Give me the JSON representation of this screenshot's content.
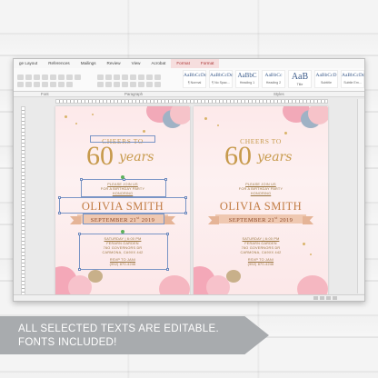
{
  "ribbon": {
    "tabs": [
      "ge Layout",
      "References",
      "Mailings",
      "Review",
      "View",
      "Acrobat",
      "Format",
      "Format"
    ],
    "group_labels": [
      "Font",
      "Paragraph",
      "Styles"
    ],
    "styles": [
      {
        "sample": "AaBbCcDc",
        "name": "¶ Normal"
      },
      {
        "sample": "AaBbCcDc",
        "name": "¶ No Spac..."
      },
      {
        "sample": "AaBbC",
        "name": "Heading 1"
      },
      {
        "sample": "AaBbCc",
        "name": "Heading 2"
      },
      {
        "sample": "AaB",
        "name": "Title"
      },
      {
        "sample": "AaBbCcD",
        "name": "Subtitle"
      },
      {
        "sample": "AaBbCcDc",
        "name": "Subtle Em..."
      }
    ]
  },
  "invitation": {
    "cheers": "CHEERS TO",
    "number": "60",
    "years": "years",
    "please": "PLEASE JOIN US",
    "for": "FOR A BIRTHDAY PARTY",
    "honoring": "HONORING",
    "name": "OLIVIA SMITH",
    "date_main": "SEPTEMBER 21",
    "date_sup": "st",
    "date_year": " 2019",
    "time": "SATURDAY | 6:00 PM",
    "venue": "FERARN GARDEN",
    "street": "76O GOVERNORS DR",
    "city": "CARMONA, CA9XX 442",
    "rsvp": "RSVP TO JANI",
    "phone": "(952) 870-4246"
  },
  "colors": {
    "gold": "#c79a4c",
    "name": "#c27c44",
    "ribbon": "#efc8b1",
    "page_bg": "#fde9ea",
    "selection": "#7a95c6",
    "caption_bg": "#a8abae"
  },
  "caption": {
    "line1": "ALL SELECTED TEXTS ARE EDITABLE.",
    "line2": "FONTS INCLUDED!"
  }
}
